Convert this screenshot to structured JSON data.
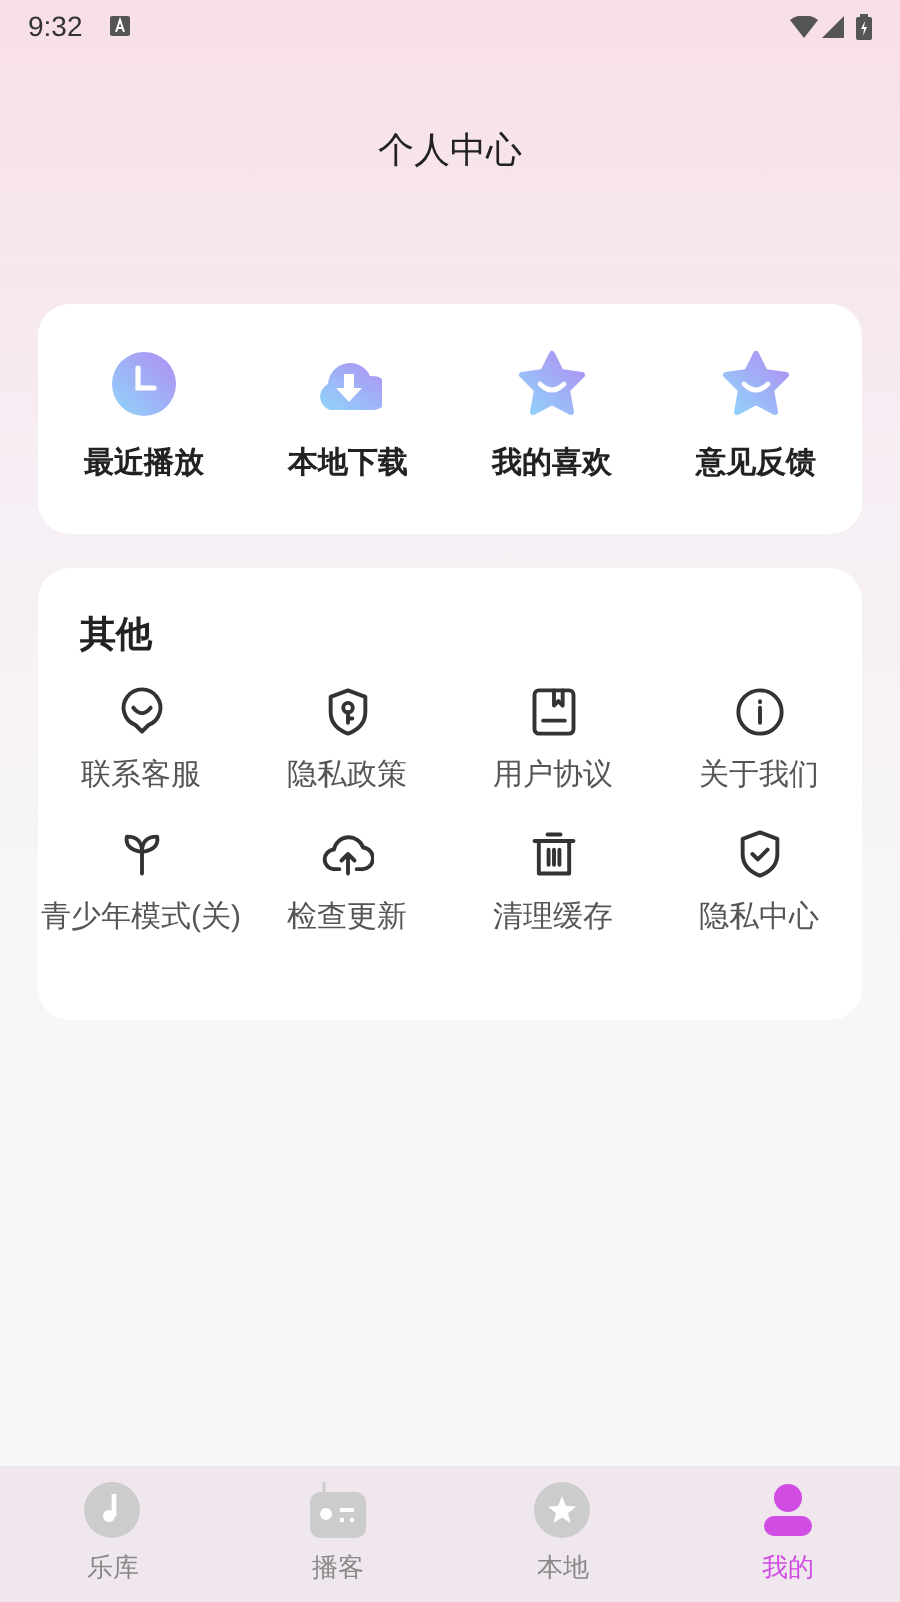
{
  "status_bar": {
    "time": "9:32"
  },
  "title": "个人中心",
  "quick_actions": [
    {
      "label": "最近播放"
    },
    {
      "label": "本地下载"
    },
    {
      "label": "我的喜欢"
    },
    {
      "label": "意见反馈"
    }
  ],
  "others": {
    "heading": "其他",
    "items": [
      {
        "label": "联系客服"
      },
      {
        "label": "隐私政策"
      },
      {
        "label": "用户协议"
      },
      {
        "label": "关于我们"
      },
      {
        "label": "青少年模式(关)"
      },
      {
        "label": "检查更新"
      },
      {
        "label": "清理缓存"
      },
      {
        "label": "隐私中心"
      }
    ]
  },
  "bottom_nav": [
    {
      "label": "乐库",
      "selected": false
    },
    {
      "label": "播客",
      "selected": false
    },
    {
      "label": "本地",
      "selected": false
    },
    {
      "label": "我的",
      "selected": true
    }
  ]
}
